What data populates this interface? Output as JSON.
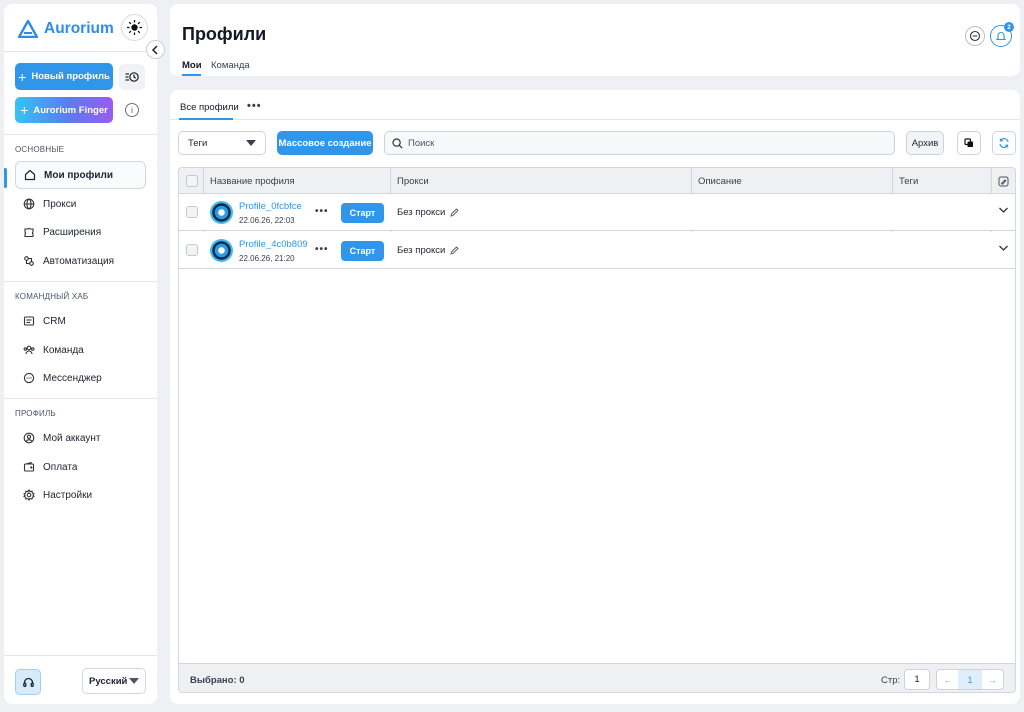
{
  "app": {
    "name": "Aurorium",
    "brand_color": "#2f96e9"
  },
  "sidebar": {
    "new_profile_label": "Новый профиль",
    "finger_label": "Aurorium Finger",
    "sections": {
      "main": "ОСНОВНЫЕ",
      "team_hub": "КОМАНДНЫЙ ХАБ",
      "profile": "ПРОФИЛЬ"
    },
    "items": [
      {
        "label": "Мои профили",
        "icon": "home-icon",
        "active": true
      },
      {
        "label": "Прокси",
        "icon": "globe-icon"
      },
      {
        "label": "Расширения",
        "icon": "puzzle-icon"
      },
      {
        "label": "Автоматизация",
        "icon": "automation-icon"
      },
      {
        "label": "CRM",
        "icon": "crm-icon"
      },
      {
        "label": "Команда",
        "icon": "team-icon"
      },
      {
        "label": "Мессенджер",
        "icon": "chat-icon"
      },
      {
        "label": "Мой аккаунт",
        "icon": "user-icon"
      },
      {
        "label": "Оплата",
        "icon": "wallet-icon"
      },
      {
        "label": "Настройки",
        "icon": "gear-icon"
      }
    ],
    "language": "Русский"
  },
  "header": {
    "title": "Профили",
    "tabs": [
      "Мои",
      "Команда"
    ],
    "notification_count": "2"
  },
  "main": {
    "subtab": "Все профили",
    "more": "•••",
    "tags_label": "Теги",
    "bulk_create_label": "Массовое создание",
    "search_placeholder": "Поиск",
    "archive_label": "Архив",
    "columns": [
      "Название профиля",
      "Прокси",
      "Описание",
      "Теги"
    ],
    "rows": [
      {
        "name": "Profile_0fcbfce",
        "date": "22.06.26, 22:03",
        "start": "Старт",
        "proxy": "Без прокси",
        "more": "•••"
      },
      {
        "name": "Profile_4c0b809",
        "date": "22.06.26, 21:20",
        "start": "Старт",
        "proxy": "Без прокси",
        "more": "•••"
      }
    ],
    "footer": {
      "selected": "Выбрано: 0",
      "page_label": "Стр:",
      "page_value": "1",
      "current_page": "1"
    }
  }
}
